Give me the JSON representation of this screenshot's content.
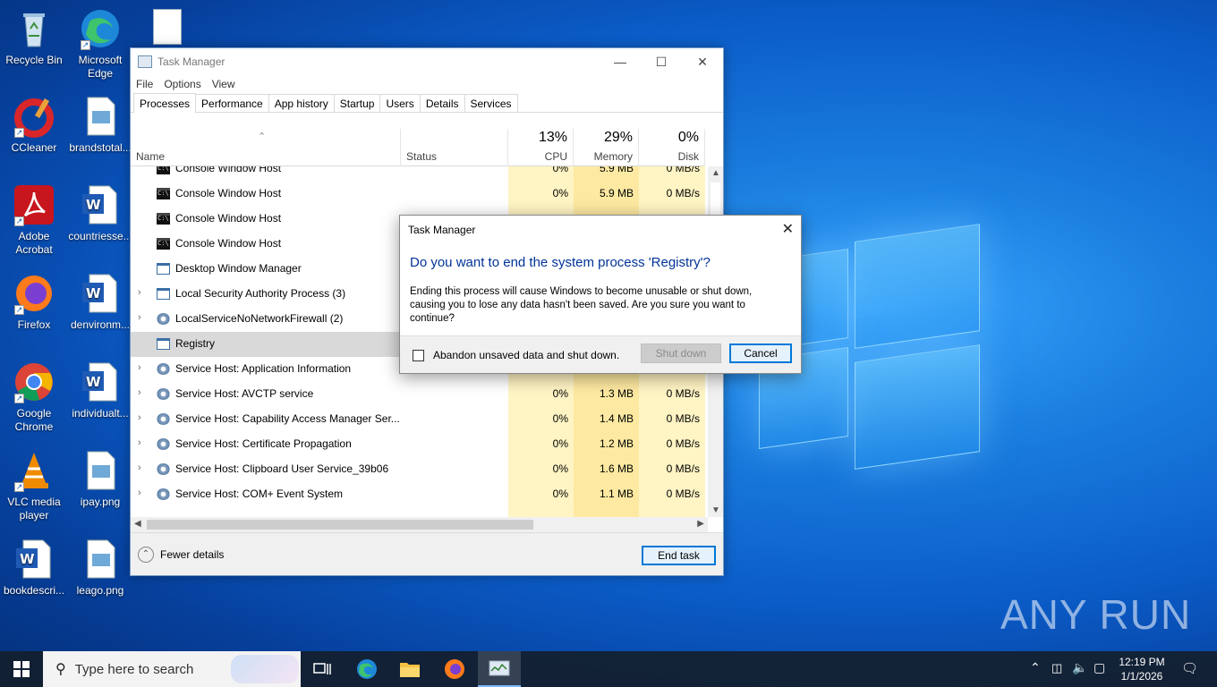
{
  "desktop": {
    "icons": [
      {
        "label": "Recycle Bin"
      },
      {
        "label": "Microsoft Edge"
      },
      {
        "label": "CCleaner"
      },
      {
        "label": "brandstotal..."
      },
      {
        "label": "Adobe Acrobat"
      },
      {
        "label": "countriesse..."
      },
      {
        "label": "Firefox"
      },
      {
        "label": "denvironm..."
      },
      {
        "label": "Google Chrome"
      },
      {
        "label": "individualt..."
      },
      {
        "label": "VLC media player"
      },
      {
        "label": "ipay.png"
      },
      {
        "label": "bookdescri..."
      },
      {
        "label": "leago.png"
      }
    ],
    "watermark": "ANY RUN"
  },
  "task_manager": {
    "title": "Task Manager",
    "menu": [
      "File",
      "Options",
      "View"
    ],
    "tabs": [
      "Processes",
      "Performance",
      "App history",
      "Startup",
      "Users",
      "Details",
      "Services"
    ],
    "active_tab": "Processes",
    "columns": {
      "name": "Name",
      "status": "Status",
      "cpu": {
        "pct": "13%",
        "label": "CPU"
      },
      "memory": {
        "pct": "29%",
        "label": "Memory"
      },
      "disk": {
        "pct": "0%",
        "label": "Disk"
      }
    },
    "rows": [
      {
        "name": "Console Window Host",
        "icon": "console-icon",
        "cpu": "0%",
        "mem": "5.9 MB",
        "disk": "0 MB/s"
      },
      {
        "name": "Console Window Host",
        "icon": "console-icon",
        "cpu": "0%",
        "mem": "5.9 MB",
        "disk": "0 MB/s"
      },
      {
        "name": "Console Window Host",
        "icon": "console-icon",
        "cpu": "",
        "mem": "",
        "disk": ""
      },
      {
        "name": "Console Window Host",
        "icon": "console-icon",
        "cpu": "",
        "mem": "",
        "disk": ""
      },
      {
        "name": "Desktop Window Manager",
        "icon": "window-icon",
        "cpu": "",
        "mem": "",
        "disk": ""
      },
      {
        "name": "Local Security Authority Process (3)",
        "icon": "window-icon",
        "cpu": "",
        "mem": "",
        "disk": ""
      },
      {
        "name": "LocalServiceNoNetworkFirewall (2)",
        "icon": "gear-icon",
        "cpu": "",
        "mem": "",
        "disk": ""
      },
      {
        "name": "Registry",
        "icon": "window-icon",
        "cpu": "",
        "mem": "",
        "disk": ""
      },
      {
        "name": "Service Host: Application Information",
        "icon": "gear-icon",
        "cpu": "",
        "mem": "",
        "disk": ""
      },
      {
        "name": "Service Host: AVCTP service",
        "icon": "gear-icon",
        "cpu": "0%",
        "mem": "1.3 MB",
        "disk": "0 MB/s"
      },
      {
        "name": "Service Host: Capability Access Manager Ser...",
        "icon": "gear-icon",
        "cpu": "0%",
        "mem": "1.4 MB",
        "disk": "0 MB/s"
      },
      {
        "name": "Service Host: Certificate Propagation",
        "icon": "gear-icon",
        "cpu": "0%",
        "mem": "1.2 MB",
        "disk": "0 MB/s"
      },
      {
        "name": "Service Host: Clipboard User Service_39b06",
        "icon": "gear-icon",
        "cpu": "0%",
        "mem": "1.6 MB",
        "disk": "0 MB/s"
      },
      {
        "name": "Service Host: COM+ Event System",
        "icon": "gear-icon",
        "cpu": "0%",
        "mem": "1.1 MB",
        "disk": "0 MB/s"
      }
    ],
    "fewer_details": "Fewer details",
    "end_task": "End task"
  },
  "dialog": {
    "title": "Task Manager",
    "heading": "Do you want to end the system process 'Registry'?",
    "message": "Ending this process will cause Windows to become unusable or shut down, causing you to lose any data hasn't been saved. Are you sure you want to continue?",
    "checkbox_label": "Abandon unsaved data and shut down.",
    "shutdown_label": "Shut down",
    "cancel_label": "Cancel"
  },
  "taskbar": {
    "search_placeholder": "Type here to search",
    "time": "12:19 PM",
    "date": "1/1/2026"
  }
}
